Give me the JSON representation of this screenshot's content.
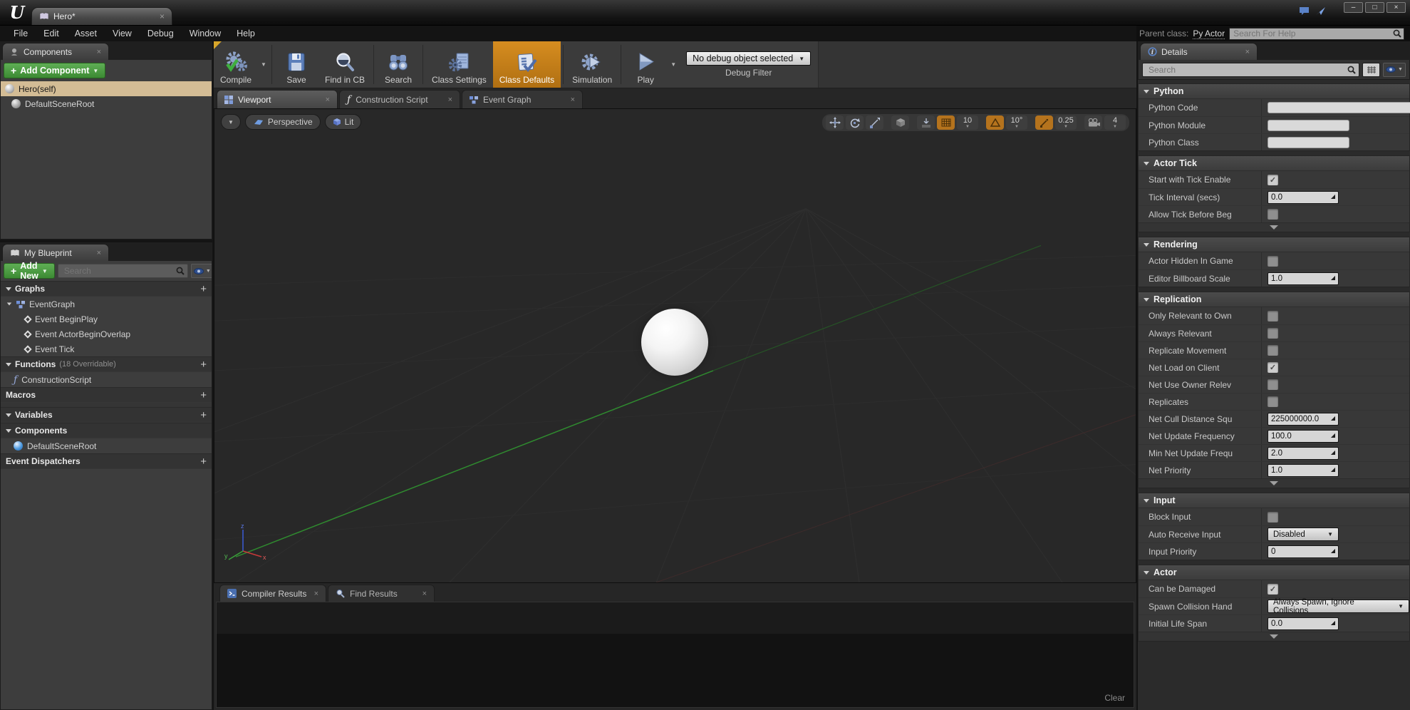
{
  "titlebar": {
    "tab_title": "Hero*"
  },
  "menubar": {
    "items": [
      "File",
      "Edit",
      "Asset",
      "View",
      "Debug",
      "Window",
      "Help"
    ],
    "parent_class_label": "Parent class:",
    "parent_class_value": "Py Actor",
    "help_search_placeholder": "Search For Help"
  },
  "toolbar": {
    "compile": "Compile",
    "save": "Save",
    "find_in_cb": "Find in CB",
    "search": "Search",
    "class_settings": "Class Settings",
    "class_defaults": "Class Defaults",
    "simulation": "Simulation",
    "play": "Play",
    "debug_dropdown": "No debug object selected",
    "debug_filter_label": "Debug Filter"
  },
  "components_panel": {
    "tab": "Components",
    "add_button": "Add Component",
    "items": [
      {
        "label": "Hero(self)",
        "selected": true
      },
      {
        "label": "DefaultSceneRoot",
        "selected": false
      }
    ]
  },
  "my_blueprint": {
    "tab": "My Blueprint",
    "add_button": "Add New",
    "search_placeholder": "Search",
    "graphs_header": "Graphs",
    "event_graph": "EventGraph",
    "events": [
      "Event BeginPlay",
      "Event ActorBeginOverlap",
      "Event Tick"
    ],
    "functions_header": "Functions",
    "functions_note": "(18 Overridable)",
    "construction_script": "ConstructionScript",
    "macros_header": "Macros",
    "variables_header": "Variables",
    "components_header": "Components",
    "scene_root": "DefaultSceneRoot",
    "event_dispatchers_header": "Event Dispatchers"
  },
  "doc_tabs": {
    "viewport": "Viewport",
    "construction_script": "Construction Script",
    "event_graph": "Event Graph"
  },
  "viewport": {
    "perspective_label": "Perspective",
    "lit_label": "Lit",
    "grid_snap_value": "10",
    "grid_snap_active": true,
    "rotation_snap_value": "10°",
    "rotation_snap_active": true,
    "scale_snap_value": "0.25",
    "scale_snap_active": true,
    "camera_speed_value": "4"
  },
  "bottom_panel": {
    "compiler_tab": "Compiler Results",
    "find_tab": "Find Results",
    "clear_label": "Clear"
  },
  "details": {
    "tab": "Details",
    "search_placeholder": "Search",
    "python": {
      "title": "Python",
      "code_label": "Python Code",
      "code_value": "",
      "module_label": "Python Module",
      "module_value": "",
      "class_label": "Python Class",
      "class_value": ""
    },
    "actor_tick": {
      "title": "Actor Tick",
      "start_label": "Start with Tick Enable",
      "start_checked": true,
      "interval_label": "Tick Interval (secs)",
      "interval_value": "0.0",
      "allow_label": "Allow Tick Before Beg",
      "allow_checked": false
    },
    "rendering": {
      "title": "Rendering",
      "hidden_label": "Actor Hidden In Game",
      "hidden_checked": false,
      "billboard_label": "Editor Billboard Scale",
      "billboard_value": "1.0"
    },
    "replication": {
      "title": "Replication",
      "only_label": "Only Relevant to Own",
      "only_checked": false,
      "always_label": "Always Relevant",
      "always_checked": false,
      "movement_label": "Replicate Movement",
      "movement_checked": false,
      "netload_label": "Net Load on Client",
      "netload_checked": true,
      "owner_label": "Net Use Owner Relev",
      "owner_checked": false,
      "replicates_label": "Replicates",
      "replicates_checked": false,
      "cull_label": "Net Cull Distance Squ",
      "cull_value": "225000000.0",
      "update_label": "Net Update Frequency",
      "update_value": "100.0",
      "minupdate_label": "Min Net Update Frequ",
      "minupdate_value": "2.0",
      "priority_label": "Net Priority",
      "priority_value": "1.0"
    },
    "input": {
      "title": "Input",
      "block_label": "Block Input",
      "block_checked": false,
      "auto_label": "Auto Receive Input",
      "auto_value": "Disabled",
      "priority_label": "Input Priority",
      "priority_value": "0"
    },
    "actor": {
      "title": "Actor",
      "damage_label": "Can be Damaged",
      "damage_checked": true,
      "spawn_label": "Spawn Collision Hand",
      "spawn_value": "Always Spawn, Ignore Collisions",
      "lifespan_label": "Initial Life Span",
      "lifespan_value": "0.0"
    }
  },
  "colors": {
    "accent_orange": "#c07018",
    "ue_green": "#3f9135",
    "selection_tan": "#d3bc95",
    "axis_green": "#2f8a2f"
  },
  "icons": {
    "app_logo": "unreal-u",
    "asset_tab": "book",
    "search_boxes": "magnifier",
    "visibility": "eye",
    "window_controls": [
      "minimize",
      "maximize",
      "close"
    ]
  }
}
